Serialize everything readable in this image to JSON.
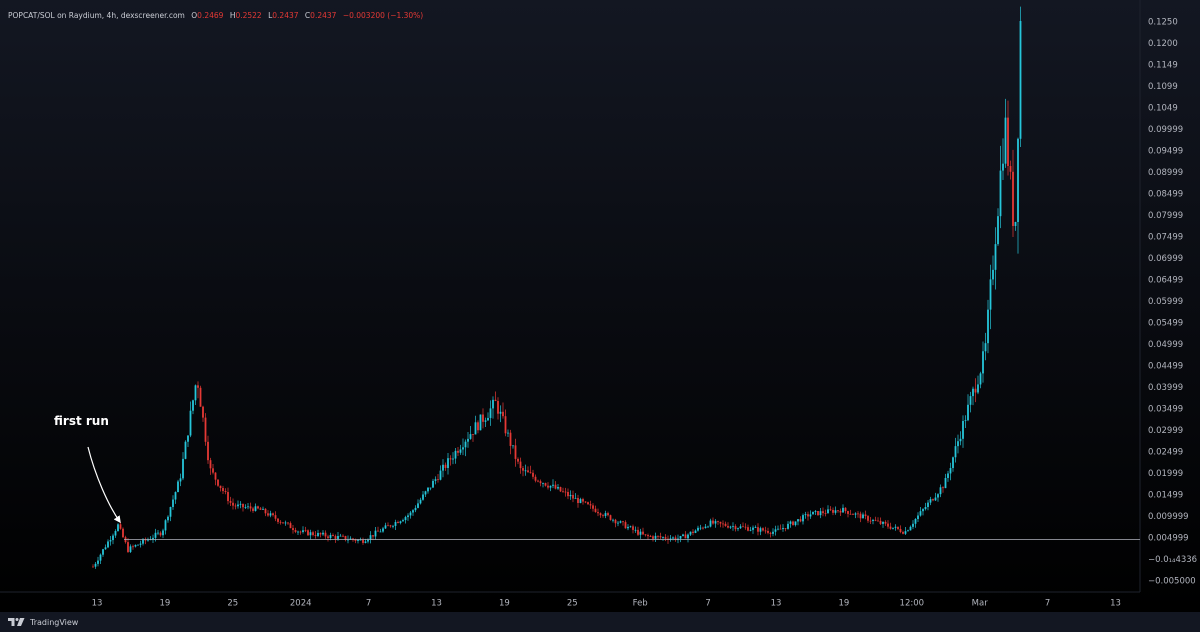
{
  "header": {
    "symbol": "POPCAT/SOL on Raydium, 4h, dexscreener.com",
    "o_label": "O",
    "o_value": "0.2469",
    "h_label": "H",
    "h_value": "0.2522",
    "l_label": "L",
    "l_value": "0.2437",
    "c_label": "C",
    "c_value": "0.2437",
    "change": "−0.003200 (−1.30%)"
  },
  "footer": {
    "brand": "TradingView"
  },
  "colors": {
    "up": "#26c6da",
    "down": "#e53935",
    "support_line": "#b2b5be",
    "axis_text": "#b2b5be",
    "bg_top": "#131722",
    "bg_bottom": "#000000"
  },
  "annotation": {
    "text": "first run"
  },
  "chart_data": {
    "type": "candlestick",
    "timeframe": "4h",
    "y_axis": {
      "side": "right",
      "labels": [
        "0.1250",
        "0.1200",
        "0.1149",
        "0.1099",
        "0.1049",
        "0.09999",
        "0.09499",
        "0.08999",
        "0.08499",
        "0.07999",
        "0.07499",
        "0.06999",
        "0.06499",
        "0.05999",
        "0.05499",
        "0.04999",
        "0.04499",
        "0.03999",
        "0.03499",
        "0.02999",
        "0.02499",
        "0.01999",
        "0.01499",
        "0.009999",
        "0.004999",
        "−0.0₁₄4336",
        "−0.005000"
      ],
      "range": [
        -0.0055,
        0.1275
      ]
    },
    "x_axis": {
      "labels": [
        "13",
        "19",
        "25",
        "2024",
        "7",
        "13",
        "19",
        "25",
        "Feb",
        "7",
        "13",
        "19",
        "12:00",
        "Mar",
        "7",
        "13"
      ]
    },
    "support_level": 0.0063,
    "price_path_keypoints": [
      {
        "x": "13",
        "y": 0.0002
      },
      {
        "x": "16",
        "y": 0.0095
      },
      {
        "x": "17",
        "y": 0.004
      },
      {
        "x": "19",
        "y": 0.008
      },
      {
        "x": "21",
        "y": 0.02
      },
      {
        "x": "22",
        "y": 0.043
      },
      {
        "x": "23",
        "y": 0.022
      },
      {
        "x": "25",
        "y": 0.014
      },
      {
        "x": "28",
        "y": 0.013
      },
      {
        "x": "2024",
        "y": 0.008
      },
      {
        "x": "7",
        "y": 0.006
      },
      {
        "x": "13",
        "y": 0.012
      },
      {
        "x": "16",
        "y": 0.028
      },
      {
        "x": "19",
        "y": 0.037
      },
      {
        "x": "21",
        "y": 0.022
      },
      {
        "x": "25",
        "y": 0.016
      },
      {
        "x": "Feb",
        "y": 0.007
      },
      {
        "x": "5",
        "y": 0.0065
      },
      {
        "x": "7",
        "y": 0.01
      },
      {
        "x": "13",
        "y": 0.008
      },
      {
        "x": "16",
        "y": 0.012
      },
      {
        "x": "19",
        "y": 0.013
      },
      {
        "x": "12:00",
        "y": 0.008
      },
      {
        "x": "Mar",
        "y": 0.019
      },
      {
        "x": "3",
        "y": 0.048
      },
      {
        "x": "5",
        "y": 0.1
      },
      {
        "x": "6",
        "y": 0.074
      },
      {
        "x": "7",
        "y": 0.127
      }
    ]
  }
}
